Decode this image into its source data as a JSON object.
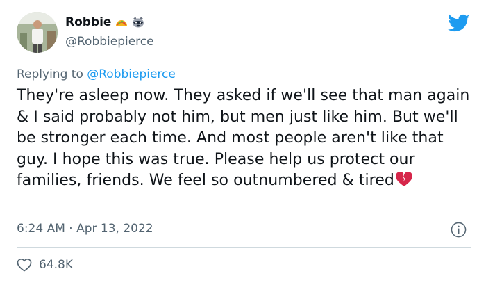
{
  "author": {
    "display_name": "Robbie",
    "handle": "@Robbiepierce",
    "badges": [
      "taco-emoji",
      "raccoon-emoji"
    ]
  },
  "reply": {
    "prefix": "Replying to",
    "mention": "@Robbiepierce"
  },
  "tweet": {
    "text": "They're asleep now. They asked if we'll see that man again & I said probably not him, but men just like him. But we'll be stronger each time. And most people aren't like that guy. I hope this was true. Please help us protect our families, friends. We feel so outnumbered & tired",
    "trailing_emoji": "broken-heart-emoji",
    "timestamp": "6:24 AM · Apr 13, 2022"
  },
  "stats": {
    "likes": "64.8K"
  },
  "colors": {
    "accent": "#1d9bf0",
    "secondary_text": "#536471",
    "broken_heart": "#d6264a"
  }
}
